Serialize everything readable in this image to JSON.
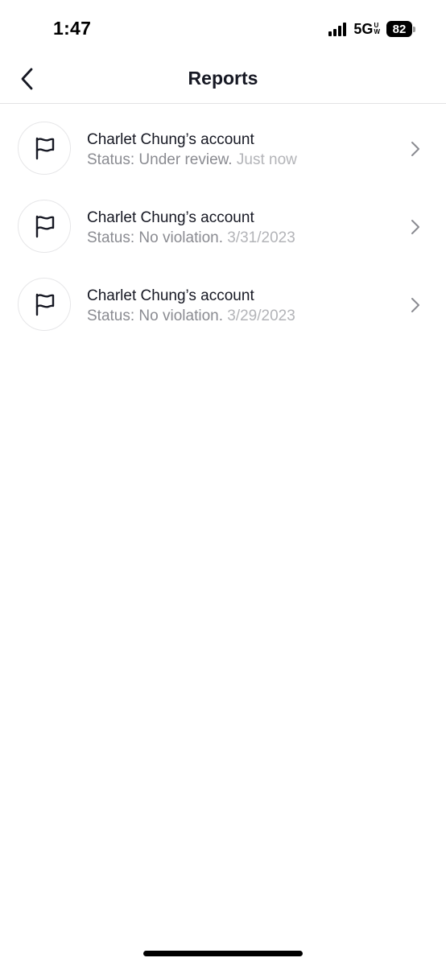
{
  "status_bar": {
    "time": "1:47",
    "network": "5G",
    "network_sup_top": "U",
    "network_sup_bottom": "W",
    "battery": "82"
  },
  "header": {
    "title": "Reports",
    "back_icon": "chevron-left-icon"
  },
  "reports": [
    {
      "icon": "flag-icon",
      "title": "Charlet Chung’s account",
      "status": "Status: Under review.",
      "time": "Just now"
    },
    {
      "icon": "flag-icon",
      "title": "Charlet Chung’s account",
      "status": "Status: No violation.",
      "time": "3/31/2023"
    },
    {
      "icon": "flag-icon",
      "title": "Charlet Chung’s account",
      "status": "Status: No violation.",
      "time": "3/29/2023"
    }
  ],
  "colors": {
    "primary_text": "#161823",
    "secondary_text": "#8a8b91",
    "tertiary_text": "#b3b4b8",
    "divider": "#e3e3e4"
  }
}
